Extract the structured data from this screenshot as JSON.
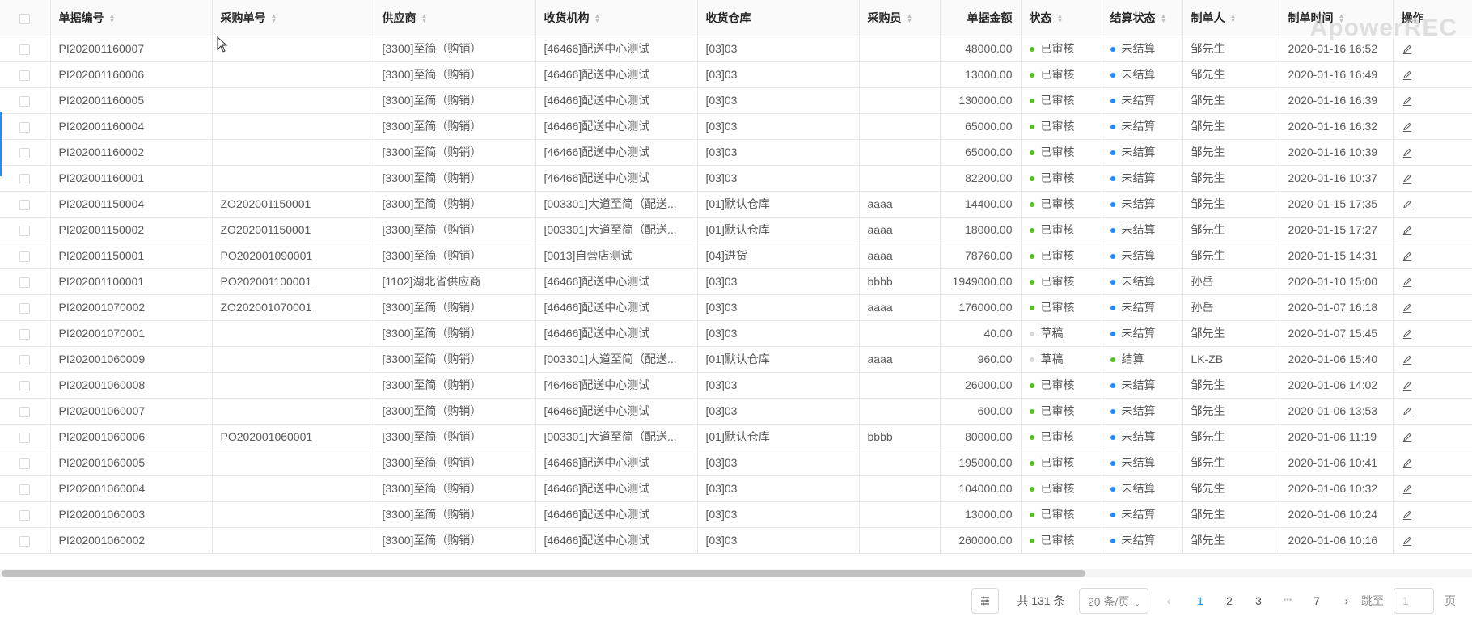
{
  "watermark": "ApowerREC",
  "columns": [
    {
      "label": "",
      "sortable": false
    },
    {
      "label": "单据编号",
      "sortable": true
    },
    {
      "label": "采购单号",
      "sortable": true
    },
    {
      "label": "供应商",
      "sortable": true
    },
    {
      "label": "收货机构",
      "sortable": true
    },
    {
      "label": "收货仓库",
      "sortable": false
    },
    {
      "label": "采购员",
      "sortable": true
    },
    {
      "label": "单据金额",
      "sortable": false
    },
    {
      "label": "状态",
      "sortable": true
    },
    {
      "label": "结算状态",
      "sortable": true
    },
    {
      "label": "制单人",
      "sortable": true
    },
    {
      "label": "制单时间",
      "sortable": true
    },
    {
      "label": "操作",
      "sortable": false
    }
  ],
  "colors": {
    "approved": "#52c41a",
    "draft": "#d9d9d9",
    "unsettled": "#1890ff",
    "settled": "#52c41a",
    "accent": "#1890ff"
  },
  "rows": [
    {
      "no": "PI202001160007",
      "po": "",
      "supplier": "[3300]至简（购销）",
      "org": "[46466]配送中心测试",
      "wh": "[03]03",
      "buyer": "",
      "amount": "48000.00",
      "status": "已审核",
      "status_type": "approved",
      "settle": "未结算",
      "settle_type": "unsettled",
      "maker": "邹先生",
      "time": "2020-01-16 16:52"
    },
    {
      "no": "PI202001160006",
      "po": "",
      "supplier": "[3300]至简（购销）",
      "org": "[46466]配送中心测试",
      "wh": "[03]03",
      "buyer": "",
      "amount": "13000.00",
      "status": "已审核",
      "status_type": "approved",
      "settle": "未结算",
      "settle_type": "unsettled",
      "maker": "邹先生",
      "time": "2020-01-16 16:49"
    },
    {
      "no": "PI202001160005",
      "po": "",
      "supplier": "[3300]至简（购销）",
      "org": "[46466]配送中心测试",
      "wh": "[03]03",
      "buyer": "",
      "amount": "130000.00",
      "status": "已审核",
      "status_type": "approved",
      "settle": "未结算",
      "settle_type": "unsettled",
      "maker": "邹先生",
      "time": "2020-01-16 16:39"
    },
    {
      "no": "PI202001160004",
      "po": "",
      "supplier": "[3300]至简（购销）",
      "org": "[46466]配送中心测试",
      "wh": "[03]03",
      "buyer": "",
      "amount": "65000.00",
      "status": "已审核",
      "status_type": "approved",
      "settle": "未结算",
      "settle_type": "unsettled",
      "maker": "邹先生",
      "time": "2020-01-16 16:32"
    },
    {
      "no": "PI202001160002",
      "po": "",
      "supplier": "[3300]至简（购销）",
      "org": "[46466]配送中心测试",
      "wh": "[03]03",
      "buyer": "",
      "amount": "65000.00",
      "status": "已审核",
      "status_type": "approved",
      "settle": "未结算",
      "settle_type": "unsettled",
      "maker": "邹先生",
      "time": "2020-01-16 10:39"
    },
    {
      "no": "PI202001160001",
      "po": "",
      "supplier": "[3300]至简（购销）",
      "org": "[46466]配送中心测试",
      "wh": "[03]03",
      "buyer": "",
      "amount": "82200.00",
      "status": "已审核",
      "status_type": "approved",
      "settle": "未结算",
      "settle_type": "unsettled",
      "maker": "邹先生",
      "time": "2020-01-16 10:37"
    },
    {
      "no": "PI202001150004",
      "po": "ZO202001150001",
      "supplier": "[3300]至简（购销）",
      "org": "[003301]大道至简（配送...",
      "wh": "[01]默认仓库",
      "buyer": "aaaa",
      "amount": "14400.00",
      "status": "已审核",
      "status_type": "approved",
      "settle": "未结算",
      "settle_type": "unsettled",
      "maker": "邹先生",
      "time": "2020-01-15 17:35"
    },
    {
      "no": "PI202001150002",
      "po": "ZO202001150001",
      "supplier": "[3300]至简（购销）",
      "org": "[003301]大道至简（配送...",
      "wh": "[01]默认仓库",
      "buyer": "aaaa",
      "amount": "18000.00",
      "status": "已审核",
      "status_type": "approved",
      "settle": "未结算",
      "settle_type": "unsettled",
      "maker": "邹先生",
      "time": "2020-01-15 17:27"
    },
    {
      "no": "PI202001150001",
      "po": "PO202001090001",
      "supplier": "[3300]至简（购销）",
      "org": "[0013]自营店测试",
      "wh": "[04]进货",
      "buyer": "aaaa",
      "amount": "78760.00",
      "status": "已审核",
      "status_type": "approved",
      "settle": "未结算",
      "settle_type": "unsettled",
      "maker": "邹先生",
      "time": "2020-01-15 14:31"
    },
    {
      "no": "PI202001100001",
      "po": "PO202001100001",
      "supplier": "[1102]湖北省供应商",
      "org": "[46466]配送中心测试",
      "wh": "[03]03",
      "buyer": "bbbb",
      "amount": "1949000.00",
      "status": "已审核",
      "status_type": "approved",
      "settle": "未结算",
      "settle_type": "unsettled",
      "maker": "孙岳",
      "time": "2020-01-10 15:00"
    },
    {
      "no": "PI202001070002",
      "po": "ZO202001070001",
      "supplier": "[3300]至简（购销）",
      "org": "[46466]配送中心测试",
      "wh": "[03]03",
      "buyer": "aaaa",
      "amount": "176000.00",
      "status": "已审核",
      "status_type": "approved",
      "settle": "未结算",
      "settle_type": "unsettled",
      "maker": "孙岳",
      "time": "2020-01-07 16:18"
    },
    {
      "no": "PI202001070001",
      "po": "",
      "supplier": "[3300]至简（购销）",
      "org": "[46466]配送中心测试",
      "wh": "[03]03",
      "buyer": "",
      "amount": "40.00",
      "status": "草稿",
      "status_type": "draft",
      "settle": "未结算",
      "settle_type": "unsettled",
      "maker": "邹先生",
      "time": "2020-01-07 15:45"
    },
    {
      "no": "PI202001060009",
      "po": "",
      "supplier": "[3300]至简（购销）",
      "org": "[003301]大道至简（配送...",
      "wh": "[01]默认仓库",
      "buyer": "aaaa",
      "amount": "960.00",
      "status": "草稿",
      "status_type": "draft",
      "settle": "结算",
      "settle_type": "settled",
      "maker": "LK-ZB",
      "time": "2020-01-06 15:40"
    },
    {
      "no": "PI202001060008",
      "po": "",
      "supplier": "[3300]至简（购销）",
      "org": "[46466]配送中心测试",
      "wh": "[03]03",
      "buyer": "",
      "amount": "26000.00",
      "status": "已审核",
      "status_type": "approved",
      "settle": "未结算",
      "settle_type": "unsettled",
      "maker": "邹先生",
      "time": "2020-01-06 14:02"
    },
    {
      "no": "PI202001060007",
      "po": "",
      "supplier": "[3300]至简（购销）",
      "org": "[46466]配送中心测试",
      "wh": "[03]03",
      "buyer": "",
      "amount": "600.00",
      "status": "已审核",
      "status_type": "approved",
      "settle": "未结算",
      "settle_type": "unsettled",
      "maker": "邹先生",
      "time": "2020-01-06 13:53"
    },
    {
      "no": "PI202001060006",
      "po": "PO202001060001",
      "supplier": "[3300]至简（购销）",
      "org": "[003301]大道至简（配送...",
      "wh": "[01]默认仓库",
      "buyer": "bbbb",
      "amount": "80000.00",
      "status": "已审核",
      "status_type": "approved",
      "settle": "未结算",
      "settle_type": "unsettled",
      "maker": "邹先生",
      "time": "2020-01-06 11:19"
    },
    {
      "no": "PI202001060005",
      "po": "",
      "supplier": "[3300]至简（购销）",
      "org": "[46466]配送中心测试",
      "wh": "[03]03",
      "buyer": "",
      "amount": "195000.00",
      "status": "已审核",
      "status_type": "approved",
      "settle": "未结算",
      "settle_type": "unsettled",
      "maker": "邹先生",
      "time": "2020-01-06 10:41"
    },
    {
      "no": "PI202001060004",
      "po": "",
      "supplier": "[3300]至简（购销）",
      "org": "[46466]配送中心测试",
      "wh": "[03]03",
      "buyer": "",
      "amount": "104000.00",
      "status": "已审核",
      "status_type": "approved",
      "settle": "未结算",
      "settle_type": "unsettled",
      "maker": "邹先生",
      "time": "2020-01-06 10:32"
    },
    {
      "no": "PI202001060003",
      "po": "",
      "supplier": "[3300]至简（购销）",
      "org": "[46466]配送中心测试",
      "wh": "[03]03",
      "buyer": "",
      "amount": "13000.00",
      "status": "已审核",
      "status_type": "approved",
      "settle": "未结算",
      "settle_type": "unsettled",
      "maker": "邹先生",
      "time": "2020-01-06 10:24"
    },
    {
      "no": "PI202001060002",
      "po": "",
      "supplier": "[3300]至简（购销）",
      "org": "[46466]配送中心测试",
      "wh": "[03]03",
      "buyer": "",
      "amount": "260000.00",
      "status": "已审核",
      "status_type": "approved",
      "settle": "未结算",
      "settle_type": "unsettled",
      "maker": "邹先生",
      "time": "2020-01-06 10:16"
    }
  ],
  "pagination": {
    "total_text": "共 131 条",
    "page_size": "20 条/页",
    "pages": [
      "1",
      "2",
      "3",
      "•••",
      "7"
    ],
    "current_page": "1",
    "jump_label": "跳至",
    "jump_value": "1",
    "page_suffix": "页"
  }
}
